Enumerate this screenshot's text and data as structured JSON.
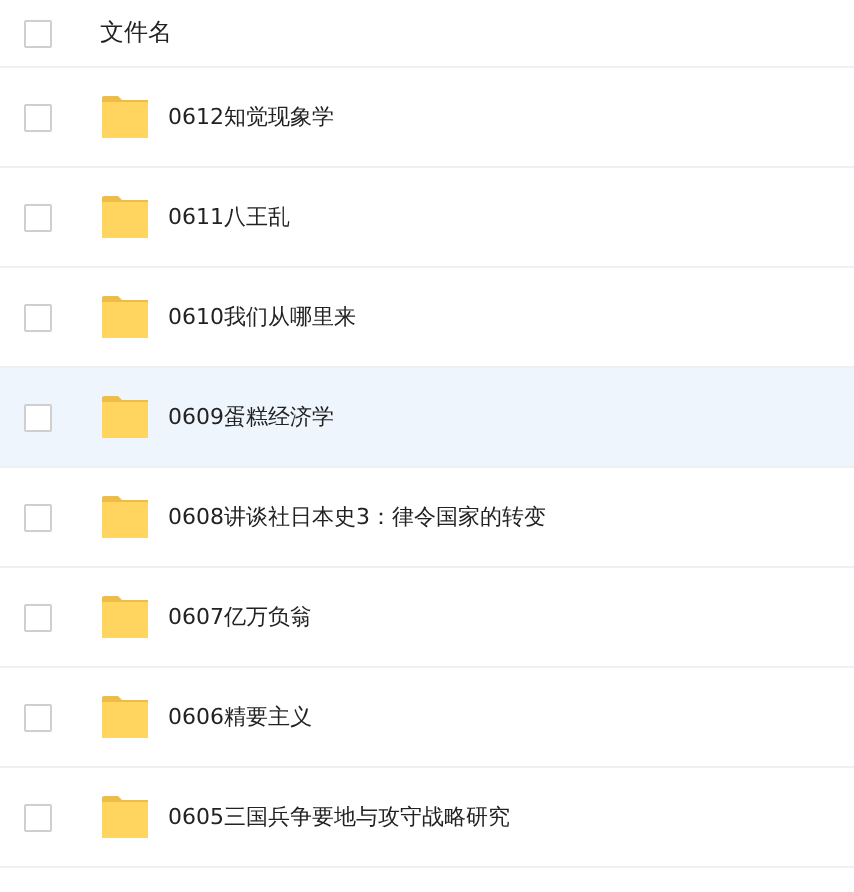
{
  "header": {
    "label": "文件名",
    "checked": false
  },
  "rows": [
    {
      "name": "0612知觉现象学",
      "checked": false,
      "selected": false
    },
    {
      "name": "0611八王乱",
      "checked": false,
      "selected": false
    },
    {
      "name": "0610我们从哪里来",
      "checked": false,
      "selected": false
    },
    {
      "name": "0609蛋糕经济学",
      "checked": false,
      "selected": true
    },
    {
      "name": "0608讲谈社日本史3：律令国家的转变",
      "checked": false,
      "selected": false
    },
    {
      "name": "0607亿万负翁",
      "checked": false,
      "selected": false
    },
    {
      "name": "0606精要主义",
      "checked": false,
      "selected": false
    },
    {
      "name": "0605三国兵争要地与攻守战略研究",
      "checked": false,
      "selected": false
    }
  ]
}
